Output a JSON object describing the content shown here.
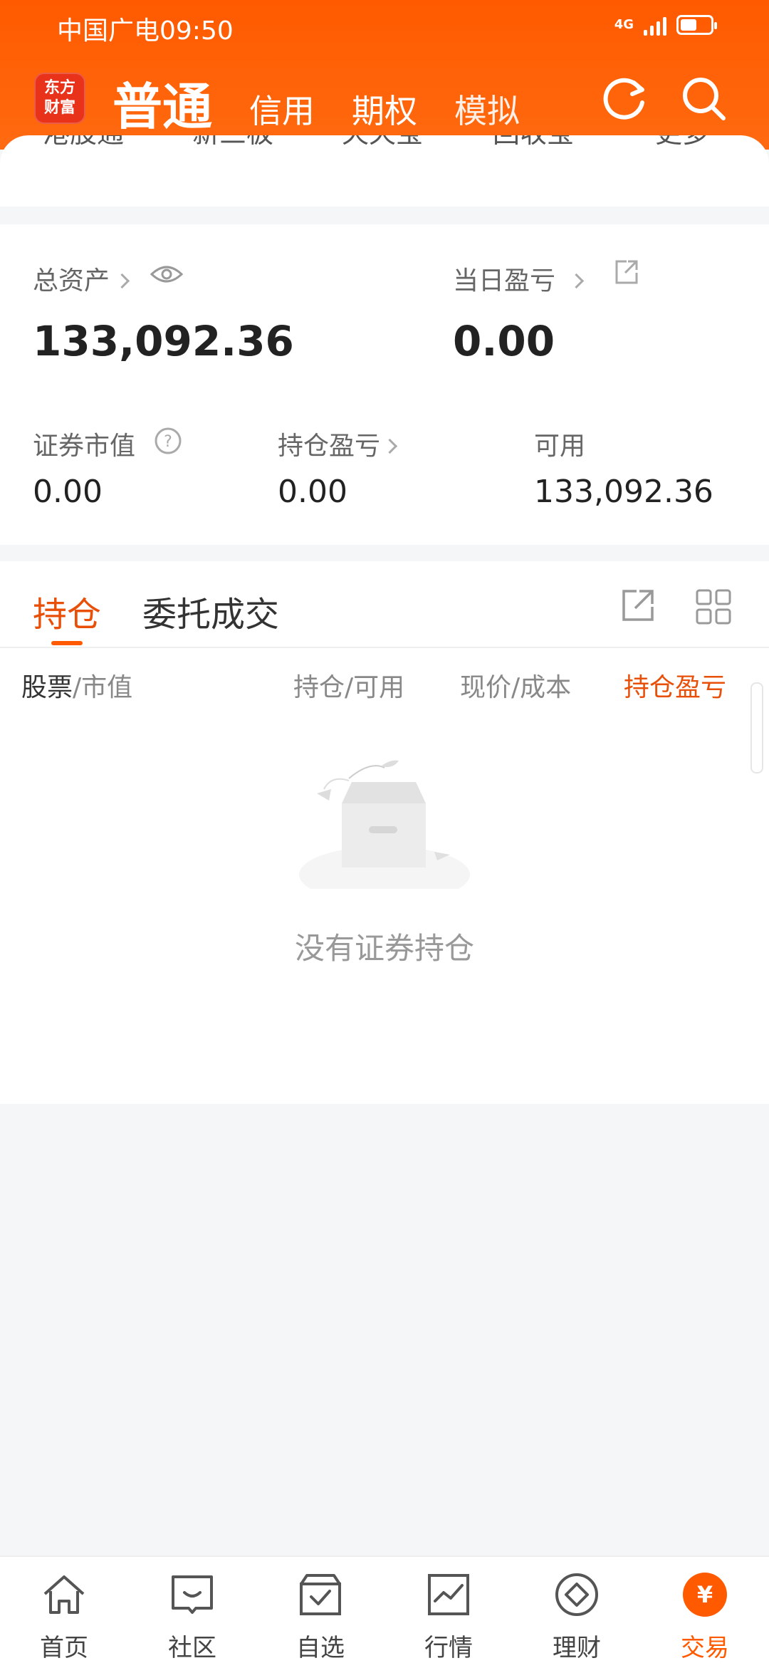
{
  "status_bar": {
    "carrier_time": "中国广电09:50",
    "network": "4G"
  },
  "header": {
    "logo": "东方财富",
    "tabs": [
      {
        "label": "普通",
        "active": true
      },
      {
        "label": "信用",
        "active": false
      },
      {
        "label": "期权",
        "active": false
      },
      {
        "label": "模拟",
        "active": false
      }
    ],
    "icons": [
      "refresh-icon",
      "search-icon"
    ]
  },
  "shortcuts": [
    "港股通",
    "新三板",
    "天天宝",
    "回收宝",
    "更多"
  ],
  "assets": {
    "total_label": "总资产",
    "total_value": "133,092.36",
    "daily_pl_label": "当日盈亏",
    "daily_pl_value": "0.00",
    "market_value_label": "证券市值",
    "market_value": "0.00",
    "position_pl_label": "持仓盈亏",
    "position_pl_value": "0.00",
    "available_label": "可用",
    "available_value": "133,092.36"
  },
  "positions": {
    "tabs": [
      {
        "label": "持仓",
        "active": true
      },
      {
        "label": "委托成交",
        "active": false
      }
    ],
    "columns": {
      "stock": "股票",
      "market": "/市值",
      "holding": "持仓/可用",
      "price": "现价/成本",
      "pl": "持仓盈亏"
    },
    "empty_text": "没有证券持仓"
  },
  "bottom_nav": [
    {
      "label": "首页",
      "icon": "home-icon",
      "active": false
    },
    {
      "label": "社区",
      "icon": "community-icon",
      "active": false
    },
    {
      "label": "自选",
      "icon": "watchlist-icon",
      "active": false
    },
    {
      "label": "行情",
      "icon": "market-icon",
      "active": false
    },
    {
      "label": "理财",
      "icon": "wealth-icon",
      "active": false
    },
    {
      "label": "交易",
      "icon": "trade-icon",
      "active": true
    }
  ],
  "colors": {
    "accent": "#ff5a00",
    "accent_text": "#e8500a"
  }
}
